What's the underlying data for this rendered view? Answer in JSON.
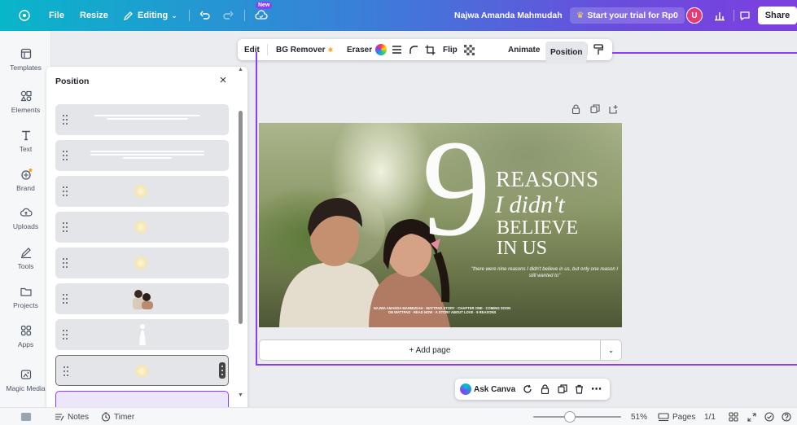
{
  "topbar": {
    "file_label": "File",
    "resize_label": "Resize",
    "editing_label": "Editing",
    "new_badge": "New",
    "user_name": "Najwa Amanda Mahmudah",
    "trial_label": "Start your trial for Rp0",
    "avatar_initial": "U",
    "share_label": "Share"
  },
  "rail": {
    "items": [
      {
        "label": "Templates"
      },
      {
        "label": "Elements"
      },
      {
        "label": "Text"
      },
      {
        "label": "Brand"
      },
      {
        "label": "Uploads"
      },
      {
        "label": "Tools"
      },
      {
        "label": "Projects"
      },
      {
        "label": "Apps"
      },
      {
        "label": "Magic Media"
      }
    ]
  },
  "panel": {
    "title": "Position",
    "close": "×"
  },
  "context_toolbar": {
    "edit": "Edit",
    "bg_remover": "BG Remover",
    "eraser": "Eraser",
    "flip": "Flip",
    "animate": "Animate",
    "position": "Position"
  },
  "design": {
    "nine": "9",
    "reasons": "REASONS",
    "didnt": "I didn't",
    "believe": "BELIEVE",
    "in_us": "IN US",
    "quote": "\"there were nine reasons I didn't believe in us, but only one reason I still wanted to\"",
    "credits": "NAJWA AMANDA MAHMUDAH · WATTPAD STORY · CHAPTER ONE · COMING SOON ON WATTPAD · READ NOW · A STORY ABOUT LOVE · 9 REASONS"
  },
  "canvas": {
    "add_page": "+ Add page"
  },
  "askbar": {
    "ask_canva": "Ask Canva"
  },
  "bottombar": {
    "notes": "Notes",
    "timer": "Timer",
    "zoom": "51%",
    "pages_label": "Pages",
    "page_count": "1/1"
  },
  "colors": {
    "accent": "#8b3dff",
    "topbar_start": "#08b6c9",
    "topbar_end": "#7d3fe0"
  }
}
